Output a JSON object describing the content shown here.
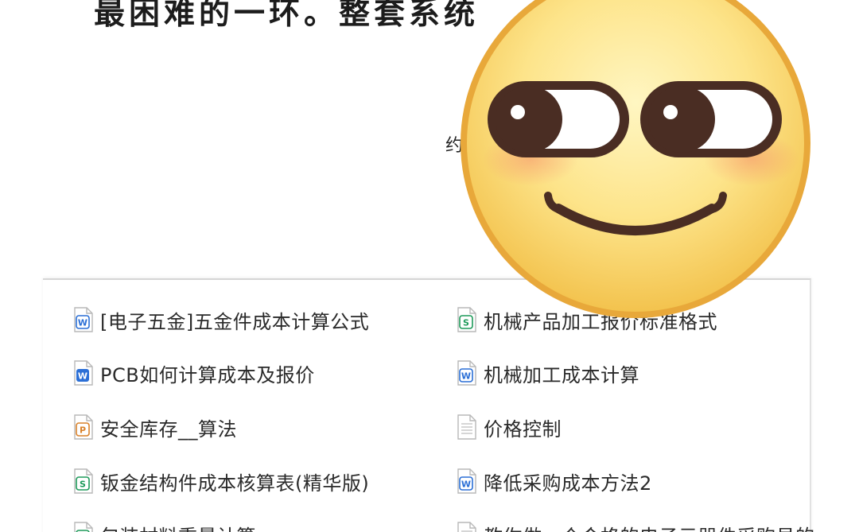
{
  "headline": "最困难的一环。整套系统",
  "partial_char": "约",
  "files": [
    {
      "name": "[电子五金]五金件成本计算公式",
      "icon": "word-doc-icon",
      "icon_color": "#2b6fd6",
      "icon_letter": "W",
      "style": "outline"
    },
    {
      "name": "机械产品加工报价标准格式",
      "icon": "spreadsheet-doc-icon",
      "icon_color": "#1e9a5a",
      "icon_letter": "S",
      "style": "outline"
    },
    {
      "name": "PCB如何计算成本及报价",
      "icon": "word-doc-icon",
      "icon_color": "#2b6fd6",
      "icon_letter": "W",
      "style": "filled"
    },
    {
      "name": "机械加工成本计算",
      "icon": "word-doc-icon",
      "icon_color": "#2b6fd6",
      "icon_letter": "W",
      "style": "outline"
    },
    {
      "name": "安全库存__算法",
      "icon": "presentation-doc-icon",
      "icon_color": "#d9822b",
      "icon_letter": "P",
      "style": "outline"
    },
    {
      "name": "价格控制",
      "icon": "text-doc-icon",
      "icon_color": "#9a9a9a",
      "icon_letter": "",
      "style": "plain"
    },
    {
      "name": "钣金结构件成本核算表(精华版)",
      "icon": "spreadsheet-doc-icon",
      "icon_color": "#1e9a5a",
      "icon_letter": "S",
      "style": "outline"
    },
    {
      "name": "降低采购成本方法2",
      "icon": "word-doc-icon",
      "icon_color": "#2b6fd6",
      "icon_letter": "W",
      "style": "outline"
    },
    {
      "name": "包装材料重量计算",
      "icon": "spreadsheet-doc-icon",
      "icon_color": "#1e9a5a",
      "icon_letter": "S",
      "style": "outline"
    },
    {
      "name": "教你做一个合格的电子元器件采购员的",
      "icon": "text-doc-icon",
      "icon_color": "#9a9a9a",
      "icon_letter": "",
      "style": "plain"
    }
  ],
  "overlay": {
    "icon": "smirk-emoji-icon"
  }
}
